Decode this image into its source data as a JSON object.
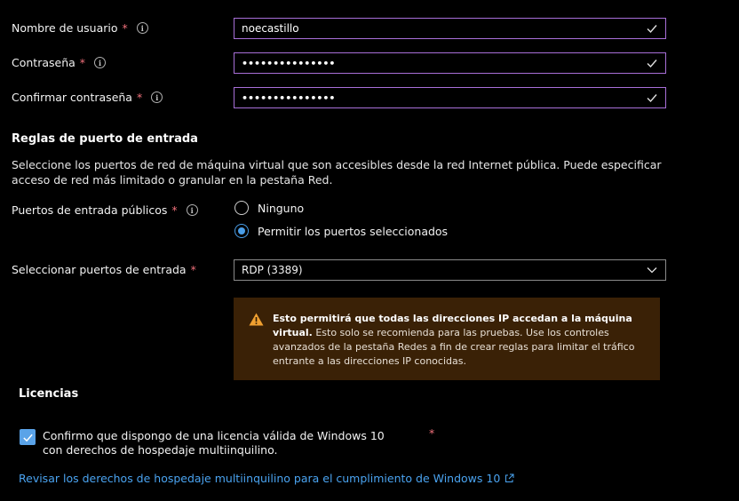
{
  "fields": {
    "username": {
      "label": "Nombre de usuario",
      "required": "*",
      "value": "noecastillo"
    },
    "password": {
      "label": "Contraseña",
      "required": "*",
      "value": "•••••••••••••••"
    },
    "confirm": {
      "label": "Confirmar contraseña",
      "required": "*",
      "value": "•••••••••••••••"
    }
  },
  "inbound": {
    "title": "Reglas de puerto de entrada",
    "description": "Seleccione los puertos de red de máquina virtual que son accesibles desde la red Internet pública. Puede especificar acceso de red más limitado o granular en la pestaña Red.",
    "public_ports": {
      "label": "Puertos de entrada públicos",
      "required": "*",
      "options": [
        "Ninguno",
        "Permitir los puertos seleccionados"
      ],
      "selected": "Permitir los puertos seleccionados"
    },
    "select_ports": {
      "label": "Seleccionar puertos de entrada",
      "required": "*",
      "value": "RDP (3389)"
    },
    "warning": {
      "bold": "Esto permitirá que todas las direcciones IP accedan a la máquina virtual.",
      "text": " Esto solo se recomienda para las pruebas.  Use los controles avanzados de la pestaña Redes a fin de crear reglas para limitar el tráfico entrante a las direcciones IP conocidas."
    }
  },
  "licenses": {
    "title": "Licencias",
    "checkbox_label": "Confirmo que dispongo de una licencia válida de Windows 10 con derechos de hospedaje multiinquilino.",
    "checked": true,
    "required": "*",
    "link": "Revisar los derechos de hospedaje multiinquilino para el cumplimiento de Windows 10"
  },
  "colors": {
    "accent": "#4a9ee8",
    "input_border": "#a86fd8",
    "required": "#f1707b",
    "warning_bg": "#3a2106",
    "link": "#4aa3f0"
  },
  "icons": {
    "info": "info-icon",
    "check": "check-icon",
    "warning": "warning-triangle-icon",
    "external": "external-link-icon",
    "chevron": "chevron-down-icon"
  }
}
